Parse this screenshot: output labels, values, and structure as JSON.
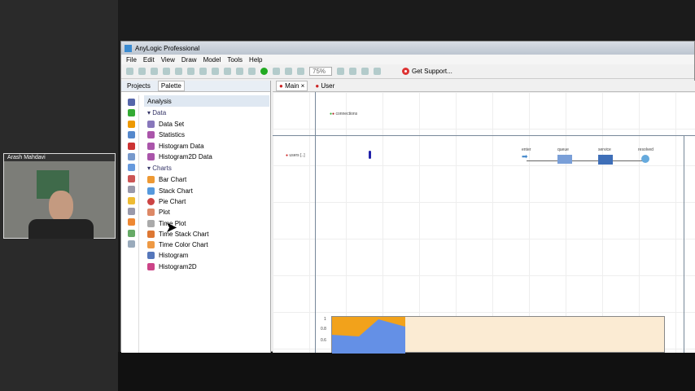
{
  "window": {
    "title": "AnyLogic Professional"
  },
  "menu": [
    "File",
    "Edit",
    "View",
    "Draw",
    "Model",
    "Tools",
    "Help"
  ],
  "toolbar": {
    "zoom": "75%",
    "support": "Get Support..."
  },
  "left_tabs": [
    "Projects",
    "Palette"
  ],
  "palette": {
    "header": "Analysis",
    "sections": [
      {
        "title": "Data",
        "items": [
          "Data Set",
          "Statistics",
          "Histogram Data",
          "Histogram2D Data"
        ]
      },
      {
        "title": "Charts",
        "items": [
          "Bar Chart",
          "Stack Chart",
          "Pie Chart",
          "Plot",
          "Time Plot",
          "Time Stack Chart",
          "Time Color Chart",
          "Histogram",
          "Histogram2D"
        ]
      }
    ]
  },
  "editor_tabs": [
    "Main",
    "User"
  ],
  "canvas": {
    "connections": "connections",
    "users": "users [..]",
    "nodes": [
      "enter",
      "queue",
      "service",
      "resolved"
    ],
    "chart_ticks": [
      "1",
      "0.8",
      "0.6"
    ]
  },
  "webcam": {
    "name": "Arash Mahdavi"
  }
}
